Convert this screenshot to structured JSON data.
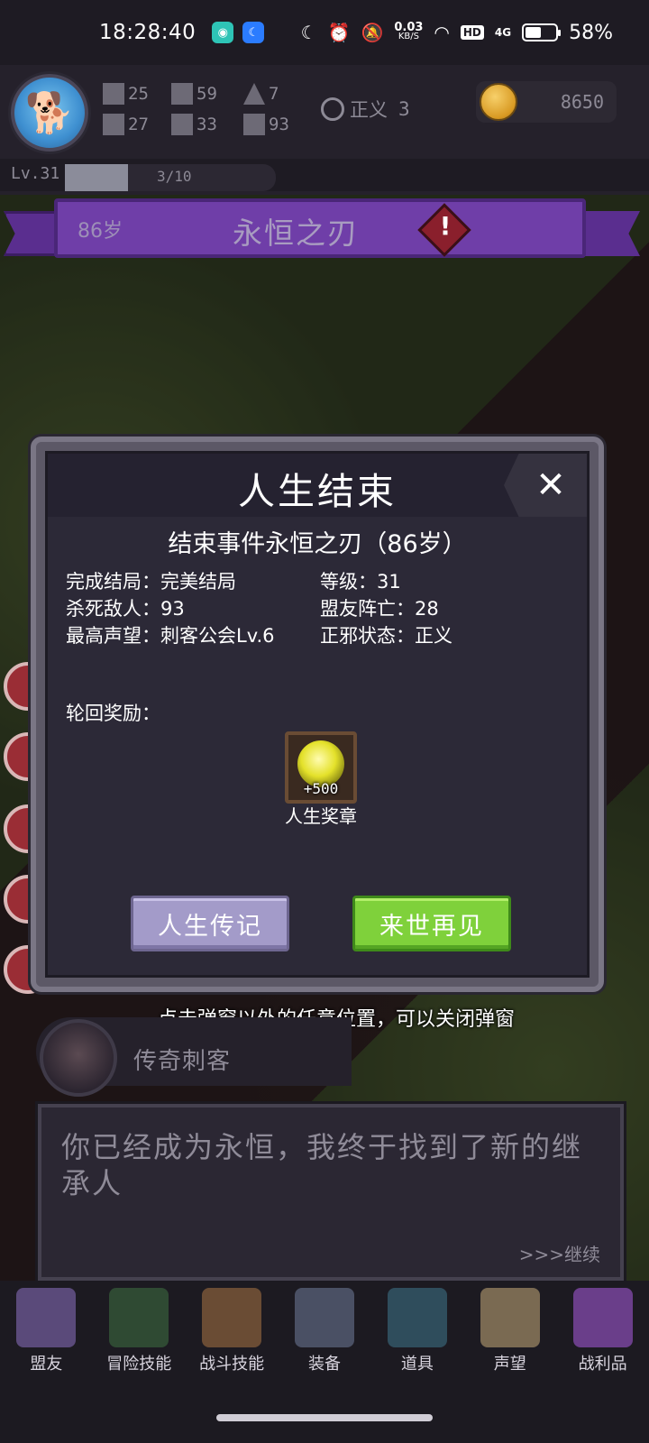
{
  "status_bar": {
    "time": "18:28:40",
    "net_speed_value": "0.03",
    "net_speed_unit": "KB/S",
    "hd": "HD",
    "signal": "4G",
    "battery": "58%",
    "battery_level": 0.58
  },
  "header": {
    "stats": [
      {
        "icon": "fist-icon",
        "value": "25"
      },
      {
        "icon": "sword-icon",
        "value": "59"
      },
      {
        "icon": "wizard-hat-icon",
        "value": "7"
      },
      {
        "icon": "clover-icon",
        "value": "27"
      },
      {
        "icon": "shield-icon",
        "value": "33"
      },
      {
        "icon": "leaf-icon",
        "value": "93"
      }
    ],
    "alignment_label": "正义",
    "alignment_value": "3",
    "coins": "8650",
    "level": "Lv.31",
    "xp_text": "3/10",
    "xp_progress": 0.3
  },
  "banner": {
    "age": "86岁",
    "title": "永恒之刃"
  },
  "modal": {
    "title": "人生结束",
    "event": "结束事件永恒之刃（86岁）",
    "info": [
      {
        "label": "完成结局：完美结局"
      },
      {
        "label": "等级：31"
      },
      {
        "label": "杀死敌人：93"
      },
      {
        "label": "盟友阵亡：28"
      },
      {
        "label": "最高声望：刺客公会Lv.6"
      },
      {
        "label": "正邪状态：正义"
      }
    ],
    "rewards_label": "轮回奖励：",
    "reward": {
      "amount": "+500",
      "name": "人生奖章"
    },
    "btn_biography": "人生传记",
    "btn_next_life": "来世再见"
  },
  "hint": "点击弹窗以外的任意位置，可以关闭弹窗",
  "character": {
    "name": "传奇刺客"
  },
  "dialogue": {
    "text": "你已经成为永恒，我终于找到了新的继承人",
    "continue": ">>>继续"
  },
  "nav": [
    {
      "label": "盟友",
      "icon": "handshake-icon"
    },
    {
      "label": "冒险技能",
      "icon": "book-icon"
    },
    {
      "label": "战斗技能",
      "icon": "backpack-icon"
    },
    {
      "label": "装备",
      "icon": "armor-icon"
    },
    {
      "label": "道具",
      "icon": "bag-icon"
    },
    {
      "label": "声望",
      "icon": "scroll-icon"
    },
    {
      "label": "战利品",
      "icon": "treasure-chest-icon"
    }
  ],
  "colors": {
    "banner": "#6f3ea8",
    "btn_biography": "#a39bc9",
    "btn_next_life": "#7fd13b",
    "panel": "#2c2937"
  }
}
